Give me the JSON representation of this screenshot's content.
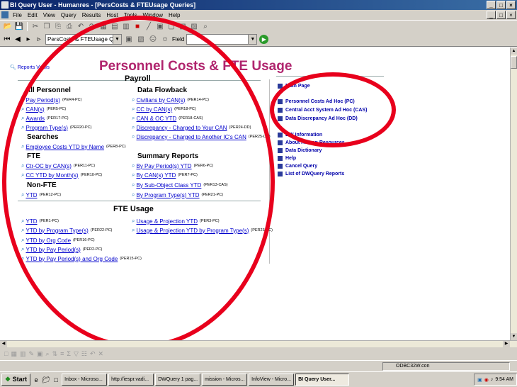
{
  "window": {
    "title": "BI Query User - Humanres - [PersCosts & FTEUsage Queries]",
    "min": "_",
    "max": "□",
    "close": "×"
  },
  "menu": [
    "File",
    "Edit",
    "View",
    "Query",
    "Results",
    "Host",
    "Tools",
    "Window",
    "Help"
  ],
  "toolbar2": {
    "doc_combo": "PersCosts & FTEUsage Q",
    "field": "Field",
    "search_value": ""
  },
  "page": {
    "reports_link": "Reports Views",
    "title": "Personnel Costs & FTE Usage",
    "payroll_title": "Payroll",
    "all_personnel": {
      "title": "All Personnel",
      "items": [
        {
          "label": "Pay Period(s)",
          "code": "(PER4-PC)"
        },
        {
          "label": "CAN(s)",
          "code": "(PER5-PC)"
        },
        {
          "label": "Awards",
          "code": "(PER17-PC)"
        },
        {
          "label": "Program Type(s)",
          "code": "(PER20-PC)"
        }
      ]
    },
    "searches": {
      "title": "Searches",
      "items": [
        {
          "label": "Employee Costs YTD by Name",
          "code": "(PER8-PC)"
        }
      ]
    },
    "fte": {
      "title": "FTE",
      "items": [
        {
          "label": "Ctr-OC by CAN(s)",
          "code": "(PER11-PC)"
        },
        {
          "label": "CC YTD by Month(s)",
          "code": "(PER10-PC)"
        }
      ]
    },
    "non_fte": {
      "title": "Non-FTE",
      "items": [
        {
          "label": "YTD",
          "code": "(PER12-PC)"
        }
      ]
    },
    "data_flowback": {
      "title": "Data Flowback",
      "items": [
        {
          "label": "Civilians by CAN(s)",
          "code": "(PER14-PC)"
        },
        {
          "label": "CC by CAN(s)",
          "code": "(PER18-PC)"
        },
        {
          "label": "CAN & OC YTD",
          "code": "(PER18-CAS)"
        },
        {
          "label": "Discrepancy - Charged to Your CAN",
          "code": "(PER24-DD)"
        },
        {
          "label": "Discrepancy - Charged to Another IC's CAN",
          "code": "(PER25-DD)"
        }
      ]
    },
    "summary_reports": {
      "title": "Summary Reports",
      "items": [
        {
          "label": "By Pay Period(s) YTD",
          "code": "(PER6-PC)"
        },
        {
          "label": "By CAN(s) YTD",
          "code": "(PER7-PC)"
        },
        {
          "label": "By Sub-Object Class YTD",
          "code": "(PER13-CAS)"
        },
        {
          "label": "By Program Type(s) YTD",
          "code": "(PER21-PC)"
        }
      ]
    },
    "fte_usage": {
      "title": "FTE Usage",
      "left": [
        {
          "label": "YTD",
          "code": "(PER1-PC)"
        },
        {
          "label": "YTD by Program Type(s)",
          "code": "(PER22-PC)"
        },
        {
          "label": "YTD by Org Code",
          "code": "(PER16-PC)"
        },
        {
          "label": "YTD by Pay Period(s)",
          "code": "(PER2-PC)"
        },
        {
          "label": "YTD by Pay Period(s) and Org Code",
          "code": "(PER15-PC)"
        }
      ],
      "right": [
        {
          "label": "Usage & Projection YTD",
          "code": "(PER3-PC)"
        },
        {
          "label": "Usage & Projection YTD by Program Type(s)",
          "code": "(PER23-PC)"
        }
      ]
    },
    "side_menu": [
      "Main Page",
      "Personnel Costs Ad Hoc (PC)",
      "Central Acct System Ad Hoc (CAS)",
      "Data Discrepancy Ad Hoc (DD)",
      "DW Information",
      "About Human Resources",
      "Data Dictionary",
      "Help",
      "Cancel Query",
      "List of DWQuery Reports"
    ]
  },
  "status": {
    "connection": "ODBC32W.con"
  },
  "taskbar": {
    "start": "Start",
    "tasks": [
      "Inbox - Microso...",
      "http://iespr.vadi...",
      "DWQuery 1 pag...",
      "mission - Micros...",
      "InfoView - Micro..."
    ],
    "active_task": "BI Query User...",
    "clock": "9:54 AM"
  }
}
